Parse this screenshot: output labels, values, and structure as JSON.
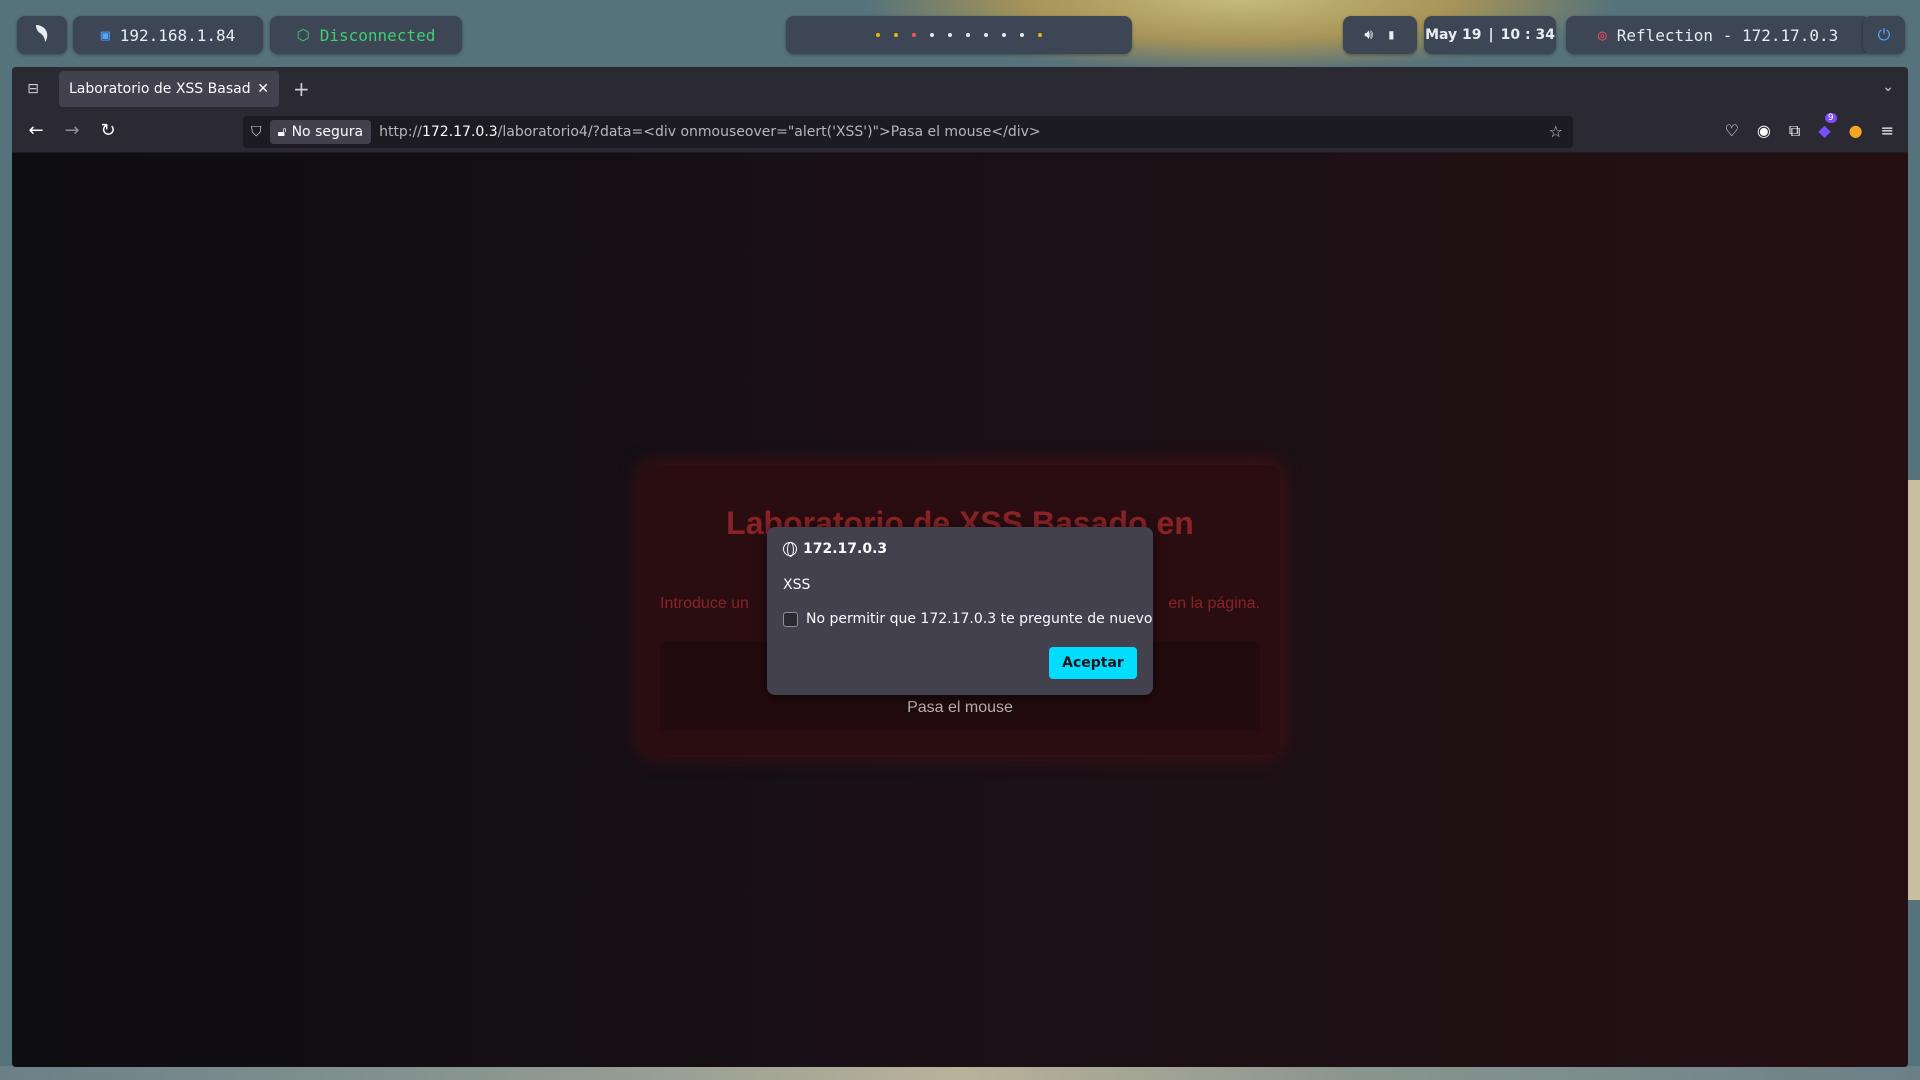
{
  "topbar": {
    "logo_icon": "kali-dragon-icon",
    "ip_icon": "network-icon",
    "ip": "192.168.1.84",
    "vpn_icon": "box-icon",
    "vpn_status": "Disconnected",
    "vpn_color": "#3ecf74",
    "workspace_count": 10,
    "workspace_dot_colors": [
      "#f0b400",
      "#f0b400",
      "#ff5050",
      "#e8e8e8",
      "#e8e8e8",
      "#e8e8e8",
      "#e8e8e8",
      "#e8e8e8",
      "#e8e8e8",
      "#f0b400"
    ],
    "volume_icon": "volume-icon",
    "battery_icon": "battery-icon",
    "clock_date": "May 19",
    "clock_time": "10 : 34",
    "target_icon": "target-icon",
    "target": "Reflection - 172.17.0.3",
    "power_icon": "power-icon"
  },
  "browser": {
    "tab_title": "Laboratorio de XSS Basado e",
    "new_tab_label": "+",
    "security_label": "No segura",
    "url_prefix": "http://",
    "url_host": "172.17.0.3",
    "url_rest": "/laboratorio4/?data=<div onmouseover=\"alert('XSS')\">Pasa el mouse</div>",
    "extension_badge": "9"
  },
  "page": {
    "title": "Laboratorio de XSS Basado en",
    "desc_left": "Introduce un",
    "desc_right": "en la página.",
    "output_text": "Pasa el mouse"
  },
  "dialog": {
    "origin": "172.17.0.3",
    "message": "XSS",
    "checkbox_label": "No permitir que 172.17.0.3 te pregunte de nuevo",
    "button_label": "Aceptar"
  }
}
